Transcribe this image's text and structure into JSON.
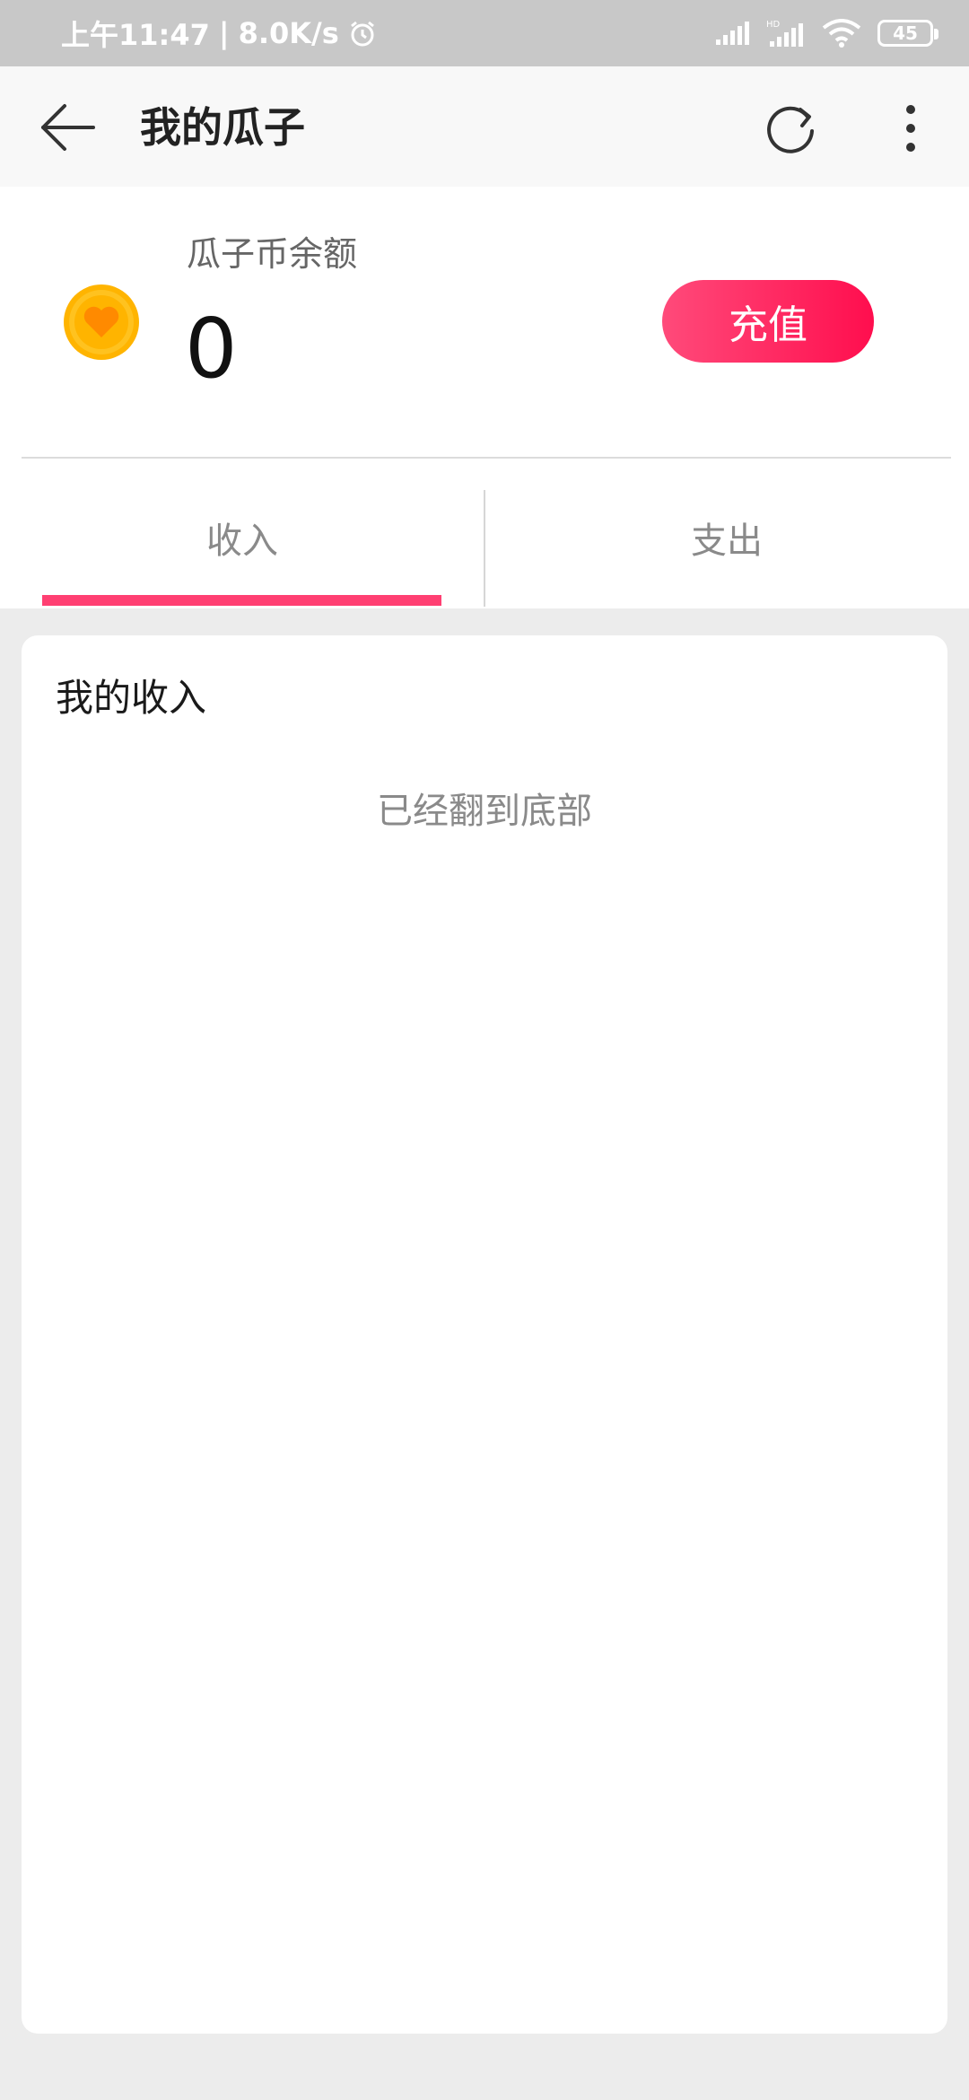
{
  "status_bar": {
    "time": "上午11:47",
    "separator": "|",
    "speed": "8.0K/s",
    "battery": "45",
    "icons": [
      "alarm-icon",
      "signal-icon",
      "hd-signal-icon",
      "wifi-icon",
      "battery-icon"
    ]
  },
  "header": {
    "title": "我的瓜子",
    "icons": [
      "back-arrow-icon",
      "refresh-icon",
      "more-vert-icon"
    ]
  },
  "balance": {
    "label": "瓜子币余额",
    "value": "0",
    "recharge_label": "充值",
    "icon": "coin-heart-icon"
  },
  "tabs": [
    {
      "label": "收入",
      "active": true
    },
    {
      "label": "支出",
      "active": false
    }
  ],
  "list": {
    "title": "我的收入",
    "end_message": "已经翻到底部"
  },
  "colors": {
    "accent": "#ff3f72",
    "recharge_gradient_start": "#ff4a7a",
    "recharge_gradient_end": "#ff0e4e",
    "coin": "#ffb400",
    "background": "#ececec"
  }
}
